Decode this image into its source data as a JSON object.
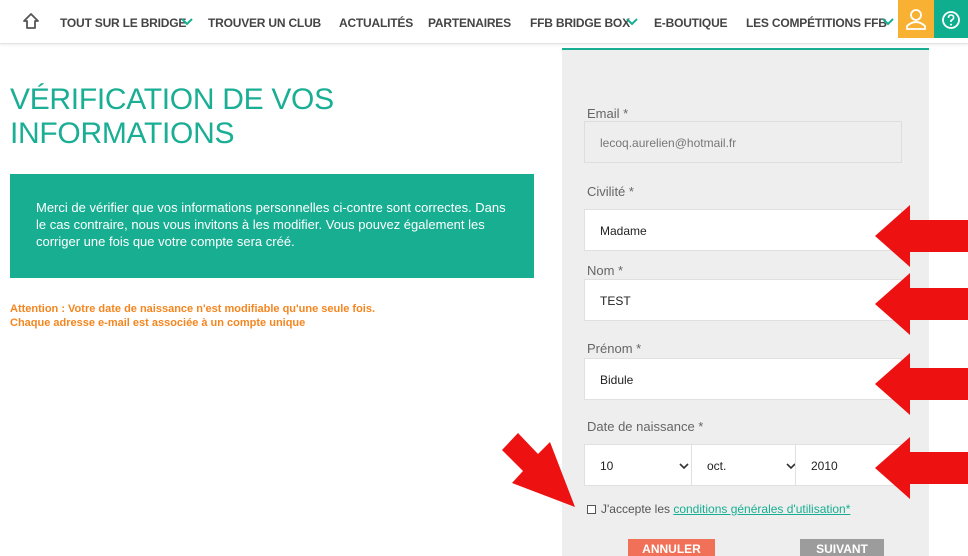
{
  "nav": {
    "items": [
      {
        "label": "TOUT SUR LE BRIDGE",
        "has_dropdown": true
      },
      {
        "label": "TROUVER UN CLUB",
        "has_dropdown": false
      },
      {
        "label": "ACTUALITÉS",
        "has_dropdown": false
      },
      {
        "label": "PARTENAIRES",
        "has_dropdown": false
      },
      {
        "label": "FFB BRIDGE BOX",
        "has_dropdown": true
      },
      {
        "label": "E-BOUTIQUE",
        "has_dropdown": false
      },
      {
        "label": "LES COMPÉTITIONS FFB",
        "has_dropdown": true
      }
    ],
    "icons": [
      "home-icon",
      "user-icon",
      "help-icon"
    ],
    "colors": {
      "user_bg": "#f8b133",
      "help_bg": "#0fae8f"
    }
  },
  "page": {
    "title_line1": "VÉRIFICATION DE VOS",
    "title_line2": "INFORMATIONS",
    "info_text": "Merci de vérifier que vos informations personnelles ci-contre sont correctes. Dans le cas contraire, nous vous invitons à les modifier. Vous pouvez également les corriger une fois que votre compte sera créé.",
    "warning_line1": "Attention : Votre date de naissance n'est modifiable qu'une seule fois.",
    "warning_line2": "Chaque adresse e-mail est associée à un compte unique"
  },
  "form": {
    "email_label": "Email *",
    "email_value": "lecoq.aurelien@hotmail.fr",
    "civilite_label": "Civilité *",
    "civilite_value": "Madame",
    "nom_label": "Nom *",
    "nom_value": "TEST",
    "prenom_label": "Prénom *",
    "prenom_value": "Bidule",
    "dob_label": "Date de naissance *",
    "dob_day": "10",
    "dob_month": "oct.",
    "dob_year": "2010",
    "accept_prefix": "J'accepte les ",
    "accept_link": "conditions générales d'utilisation*",
    "cancel_label": "ANNULER",
    "next_label": "SUIVANT"
  },
  "colors": {
    "accent": "#17ae92",
    "warning": "#f5861f",
    "cancel": "#f07058",
    "next": "#9c9c9c",
    "annotation_arrow": "#ee1111"
  }
}
